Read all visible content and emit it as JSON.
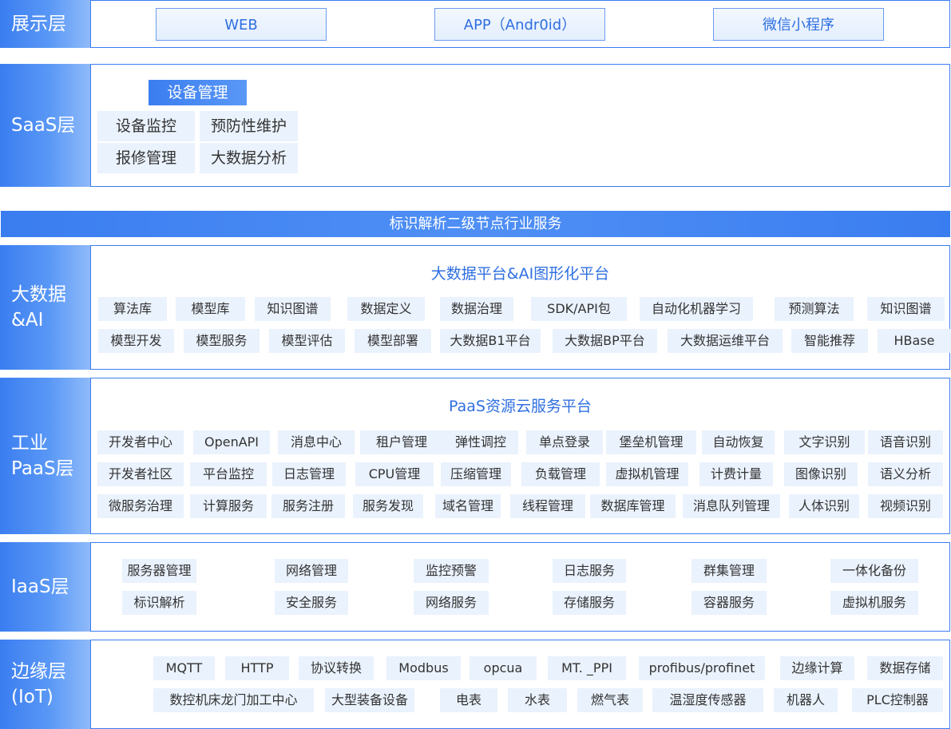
{
  "presentation": {
    "label": "展示层",
    "items": [
      "WEB",
      "APP（Andr0id）",
      "微信小程序"
    ]
  },
  "saas": {
    "label": "SaaS层",
    "header": "设备管理",
    "items": [
      "设备监控",
      "预防性维护",
      "报修管理",
      "大数据分析"
    ]
  },
  "band": {
    "title": "标识解析二级节点行业服务"
  },
  "bigdata": {
    "label": "大数据\n&AI",
    "title": "大数据平台&AI图形化平台",
    "row1": [
      "算法库",
      "模型库",
      "知识图谱",
      "数据定义",
      "数据治理",
      "SDK/API包",
      "自动化机器学习",
      "预测算法",
      "知识图谱"
    ],
    "row2": [
      "模型开发",
      "模型服务",
      "模型评估",
      "模型部署",
      "大数据B1平台",
      "大数据BP平台",
      "大数据运维平台",
      "智能推荐",
      "HBase"
    ]
  },
  "paas": {
    "label": "工业\nPaaS层",
    "title": "PaaS资源云服务平台",
    "row1": [
      "开发者中心",
      "OpenAPI",
      "消息中心",
      "租户管理",
      "弹性调控",
      "单点登录",
      "堡垒机管理",
      "自动恢复",
      "文字识别",
      "语音识别"
    ],
    "row2": [
      "开发者社区",
      "平台监控",
      "日志管理",
      "CPU管理",
      "压缩管理",
      "负载管理",
      "虚拟机管理",
      "计费计量",
      "图像识别",
      "语义分析"
    ],
    "row3": [
      "微服务治理",
      "计算服务",
      "服务注册",
      "服务发现",
      "域名管理",
      "线程管理",
      "数据库管理",
      "消息队列管理",
      "人体识别",
      "视频识别"
    ]
  },
  "iaas": {
    "label": "IaaS层",
    "row1": [
      "服务器管理",
      "网络管理",
      "监控预警",
      "日志服务",
      "群集管理",
      "一体化备份"
    ],
    "row2": [
      "标识解析",
      "安全服务",
      "网络服务",
      "存储服务",
      "容器服务",
      "虚拟机服务"
    ]
  },
  "edge": {
    "label": "边缘层\n(IoT)",
    "row1": [
      "MQTT",
      "HTTP",
      "协议转换",
      "Modbus",
      "opcua",
      "MT. _PPI",
      "profibus/profinet",
      "边缘计算",
      "数据存储"
    ],
    "row2": [
      "数控机床龙门加工中心",
      "大型装备设备",
      "电表",
      "水表",
      "燃气表",
      "温湿度传感器",
      "机器人",
      "PLC控制器"
    ]
  },
  "colors": {
    "accent": "#3a7df0",
    "tag_bg": "#eaf2fd",
    "title_text": "#2f6fe0"
  }
}
